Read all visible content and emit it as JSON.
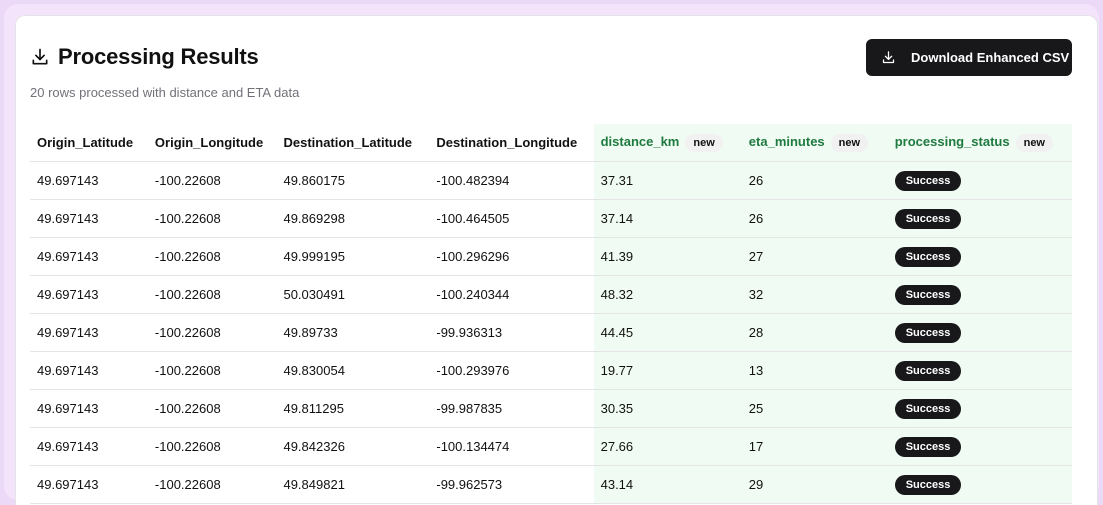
{
  "header": {
    "title": "Processing Results",
    "subtitle": "20 rows processed with distance and ETA data",
    "title_icon": "download-icon"
  },
  "download_button": {
    "label": "Download Enhanced CSV",
    "icon": "download-icon"
  },
  "table": {
    "new_tag": "new",
    "columns": [
      {
        "label": "Origin_Latitude",
        "new": false
      },
      {
        "label": "Origin_Longitude",
        "new": false
      },
      {
        "label": "Destination_Latitude",
        "new": false
      },
      {
        "label": "Destination_Longitude",
        "new": false
      },
      {
        "label": "distance_km",
        "new": true
      },
      {
        "label": "eta_minutes",
        "new": true
      },
      {
        "label": "processing_status",
        "new": true
      }
    ],
    "rows": [
      [
        "49.697143",
        "-100.22608",
        "49.860175",
        "-100.482394",
        "37.31",
        "26",
        "Success"
      ],
      [
        "49.697143",
        "-100.22608",
        "49.869298",
        "-100.464505",
        "37.14",
        "26",
        "Success"
      ],
      [
        "49.697143",
        "-100.22608",
        "49.999195",
        "-100.296296",
        "41.39",
        "27",
        "Success"
      ],
      [
        "49.697143",
        "-100.22608",
        "50.030491",
        "-100.240344",
        "48.32",
        "32",
        "Success"
      ],
      [
        "49.697143",
        "-100.22608",
        "49.89733",
        "-99.936313",
        "44.45",
        "28",
        "Success"
      ],
      [
        "49.697143",
        "-100.22608",
        "49.830054",
        "-100.293976",
        "19.77",
        "13",
        "Success"
      ],
      [
        "49.697143",
        "-100.22608",
        "49.811295",
        "-99.987835",
        "30.35",
        "25",
        "Success"
      ],
      [
        "49.697143",
        "-100.22608",
        "49.842326",
        "-100.134474",
        "27.66",
        "17",
        "Success"
      ],
      [
        "49.697143",
        "-100.22608",
        "49.849821",
        "-99.962573",
        "43.14",
        "29",
        "Success"
      ]
    ]
  },
  "colors": {
    "accent_new_column_bg": "#f0fbf3",
    "accent_new_header_text": "#1f7a3f",
    "badge_bg": "#18181b",
    "button_bg": "#18181b"
  }
}
